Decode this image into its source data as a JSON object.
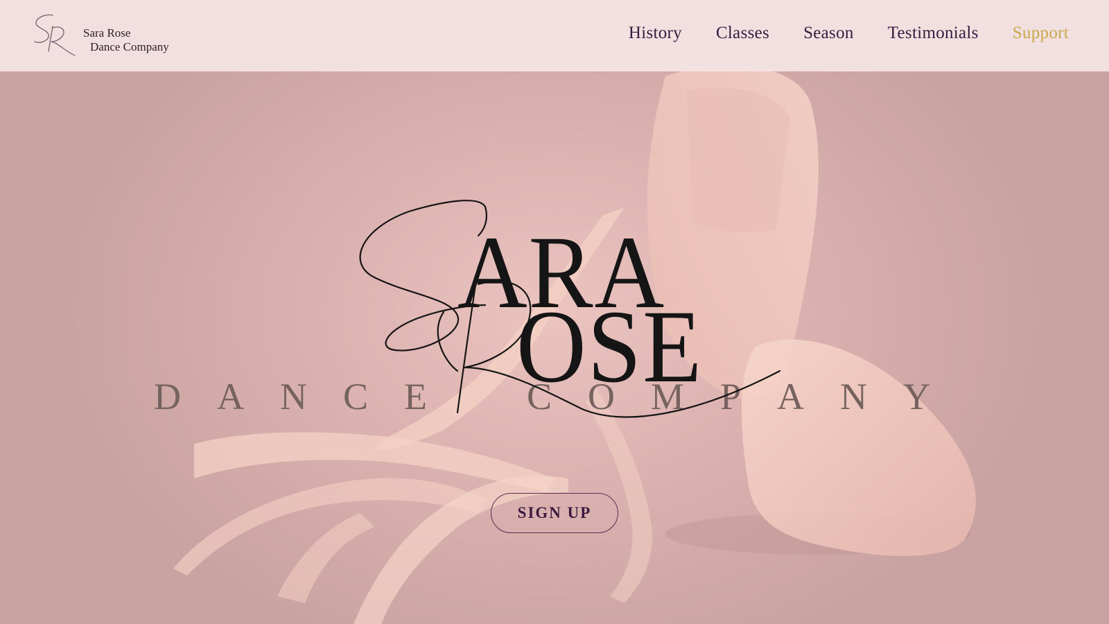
{
  "brand": {
    "line1": "Sara Rose",
    "line2": "Dance Company",
    "mark_icon": "sr-monogram-icon"
  },
  "nav": {
    "items": [
      {
        "label": "History"
      },
      {
        "label": "Classes"
      },
      {
        "label": "Season"
      },
      {
        "label": "Testimonials"
      },
      {
        "label": "Support",
        "accent": true
      }
    ]
  },
  "hero": {
    "word1_script_initial": "S",
    "word1_rest": "ARA",
    "word2_script_initial": "R",
    "word2_rest": "OSE",
    "tagline_letters": [
      "D",
      "A",
      "N",
      "C",
      "E",
      "C",
      "O",
      "M",
      "P",
      "A",
      "N",
      "Y"
    ],
    "cta_label": "SIGN UP",
    "background_image": "ballet-pointe-shoes-image"
  },
  "colors": {
    "nav_text": "#3b1a3f",
    "nav_accent": "#c9a94b",
    "header_bg": "#f4e3e4",
    "hero_bg": "#e3bbb8",
    "tagline": "#76625f"
  }
}
